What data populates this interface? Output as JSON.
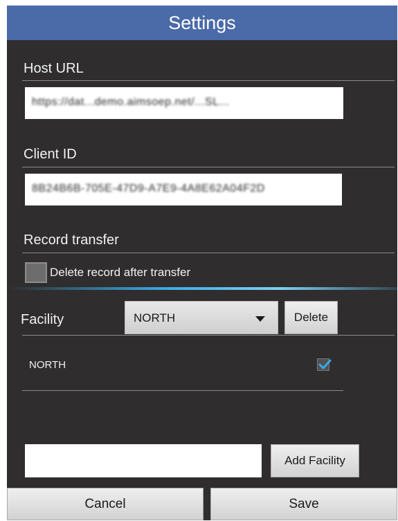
{
  "window": {
    "title": "Settings"
  },
  "host": {
    "label": "Host URL",
    "value": "https://dat...demo.aimsoep.net/...SL..."
  },
  "client": {
    "label": "Client ID",
    "value": "8B24B6B-705E-47D9-A7E9-4A8E62A04F2D"
  },
  "record": {
    "label": "Record transfer",
    "checkbox_label": "Delete record after transfer",
    "checked": false
  },
  "facility": {
    "label": "Facility",
    "selected": "NORTH",
    "delete_label": "Delete",
    "items": [
      {
        "name": "NORTH",
        "checked": true
      }
    ],
    "new_placeholder": "",
    "add_label": "Add Facility"
  },
  "actions": {
    "cancel_label": "Cancel",
    "save_label": "Save"
  },
  "colors": {
    "title_bar": "#4a6aa8",
    "background": "#2f2d2d",
    "accent": "#3aaae6"
  }
}
